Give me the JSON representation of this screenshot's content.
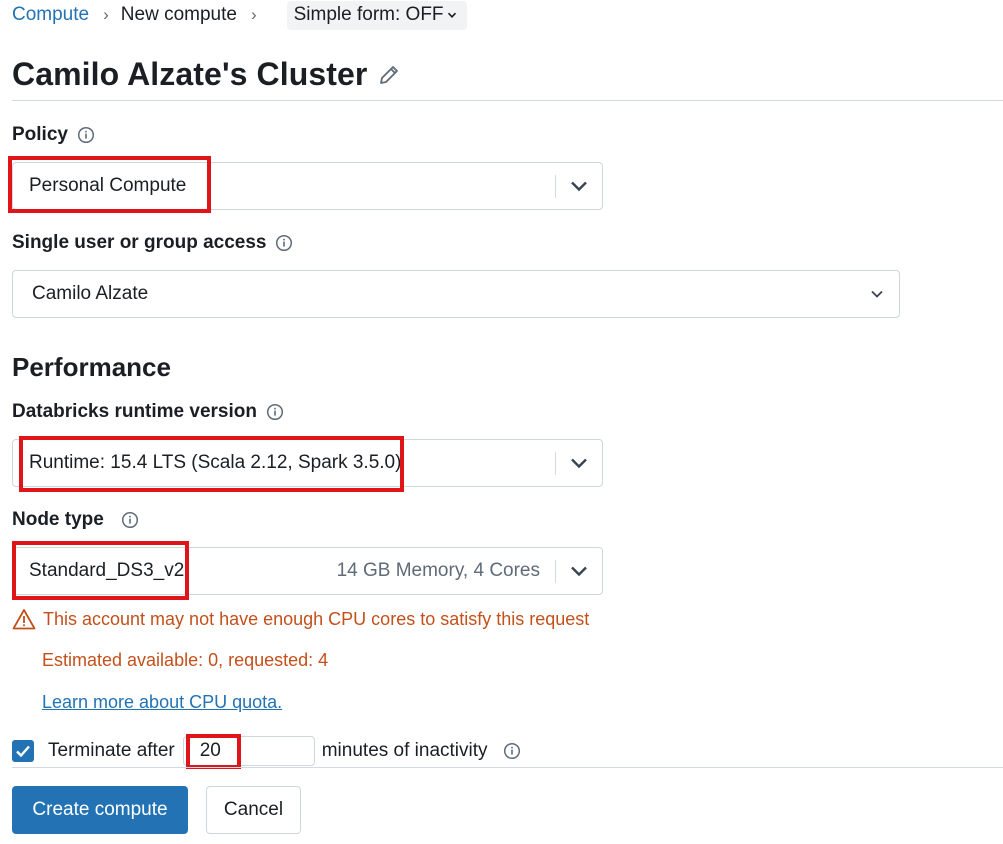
{
  "breadcrumb": {
    "root": "Compute",
    "current": "New compute",
    "simple_form": "Simple form: OFF"
  },
  "title": "Camilo Alzate's Cluster",
  "policy": {
    "label": "Policy",
    "value": "Personal Compute"
  },
  "access": {
    "label": "Single user or group access",
    "value": "Camilo Alzate"
  },
  "performance": {
    "heading": "Performance",
    "runtime": {
      "label": "Databricks runtime version",
      "value": "Runtime: 15.4 LTS (Scala 2.12, Spark 3.5.0)"
    },
    "node_type": {
      "label": "Node type",
      "value": "Standard_DS3_v2",
      "details": "14 GB Memory, 4 Cores"
    }
  },
  "warning": {
    "message": "This account may not have enough CPU cores to satisfy this request",
    "detail": "Estimated available: 0, requested: 4",
    "link": "Learn more about CPU quota."
  },
  "termination": {
    "checked": true,
    "label": "Terminate after",
    "minutes": "20",
    "suffix": "minutes of inactivity"
  },
  "actions": {
    "create": "Create compute",
    "cancel": "Cancel"
  },
  "colors": {
    "primary": "#2272b4",
    "warning": "#c4501b",
    "highlight": "#e0151a"
  },
  "icons": {
    "edit": "pencil-icon",
    "info": "info-icon",
    "chevron": "chevron-down-icon",
    "warning": "warning-triangle-icon",
    "check": "check-icon"
  }
}
